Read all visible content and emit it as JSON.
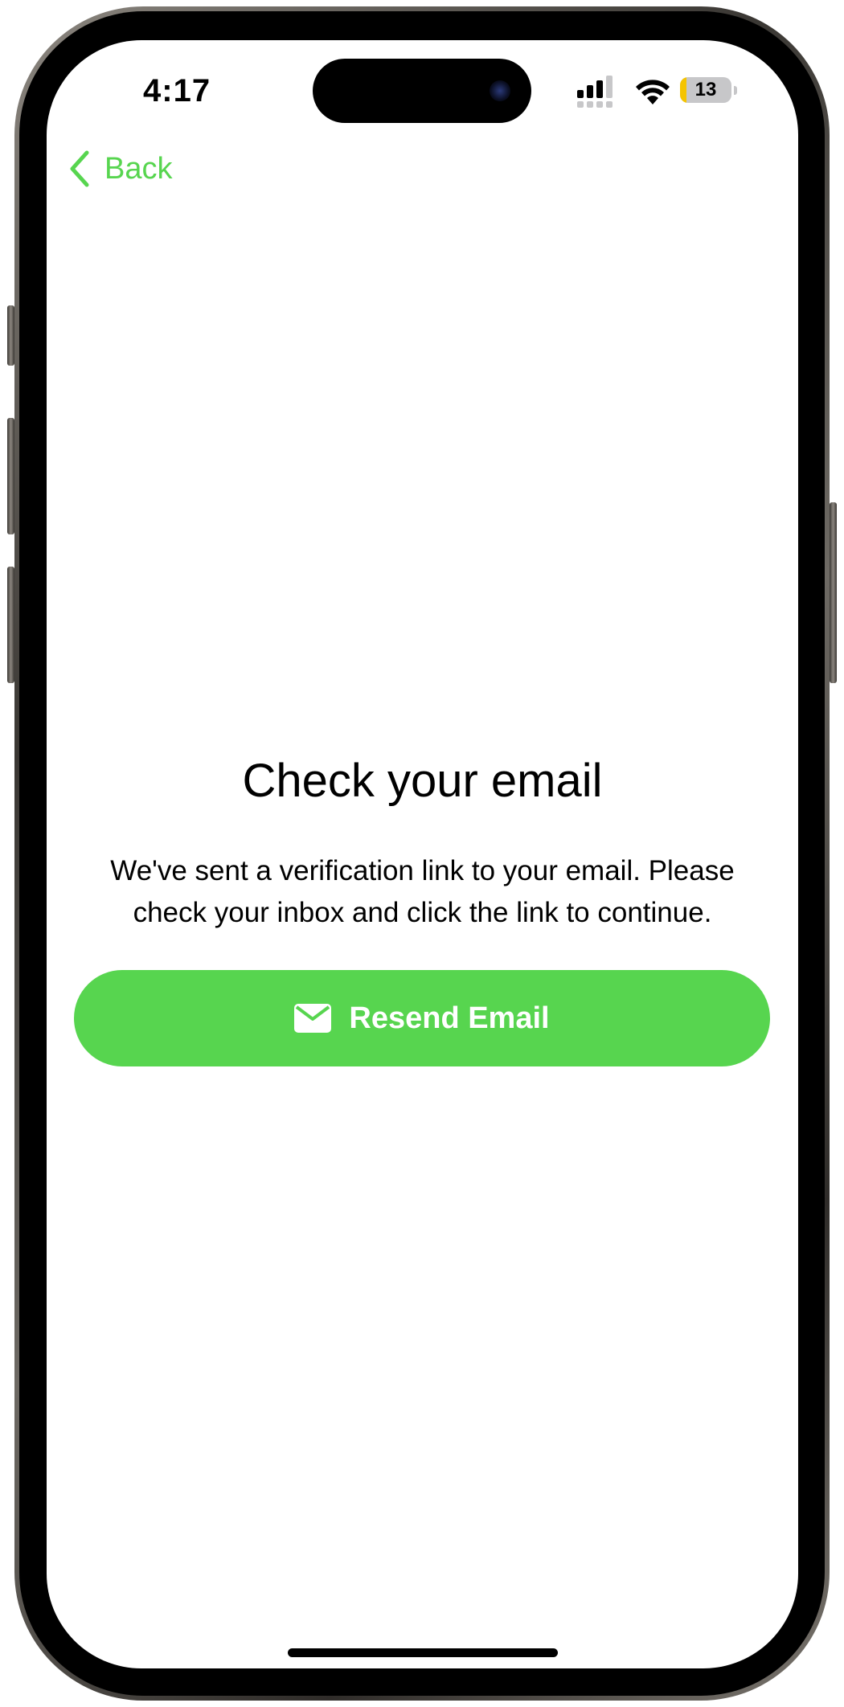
{
  "status_bar": {
    "time": "4:17",
    "battery_level": "13",
    "battery_fraction": 0.13,
    "icons": [
      "cellular-signal-icon",
      "wifi-icon",
      "battery-icon"
    ]
  },
  "nav": {
    "back_label": "Back"
  },
  "content": {
    "title": "Check your email",
    "message": "We've sent a verification link to your email. Please check your inbox and click the link to continue.",
    "resend_label": "Resend Email",
    "resend_icon": "envelope-icon"
  },
  "colors": {
    "accent": "#57d54f",
    "battery_low": "#f5c400"
  }
}
